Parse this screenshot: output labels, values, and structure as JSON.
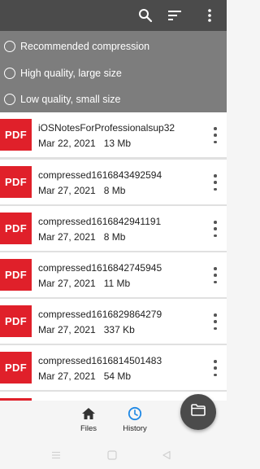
{
  "toolbar": {
    "icons": [
      "search-icon",
      "sort-icon",
      "more-vert-icon"
    ]
  },
  "compression_options": [
    {
      "label": "Recommended compression"
    },
    {
      "label": "High quality, large size"
    },
    {
      "label": "Low quality, small size"
    }
  ],
  "files": [
    {
      "badge": "PDF",
      "name": "iOSNotesForProfessionalsup32",
      "date": "Mar 22, 2021",
      "size": "13 Mb"
    },
    {
      "badge": "PDF",
      "name": "compressed1616843492594",
      "date": "Mar 27, 2021",
      "size": "8 Mb"
    },
    {
      "badge": "PDF",
      "name": "compressed1616842941191",
      "date": "Mar 27, 2021",
      "size": "8 Mb"
    },
    {
      "badge": "PDF",
      "name": "compressed1616842745945",
      "date": "Mar 27, 2021",
      "size": "11 Mb"
    },
    {
      "badge": "PDF",
      "name": "compressed1616829864279",
      "date": "Mar 27, 2021",
      "size": "337 Kb"
    },
    {
      "badge": "PDF",
      "name": "compressed1616814501483",
      "date": "Mar 27, 2021",
      "size": "54 Mb"
    }
  ],
  "bottom_nav": {
    "files_label": "Files",
    "history_label": "History",
    "active": "history"
  },
  "colors": {
    "toolbar": "#4b4b4b",
    "options_bg": "#7d7d7d",
    "pdf_badge": "#e0202a",
    "accent": "#1e88e5"
  }
}
